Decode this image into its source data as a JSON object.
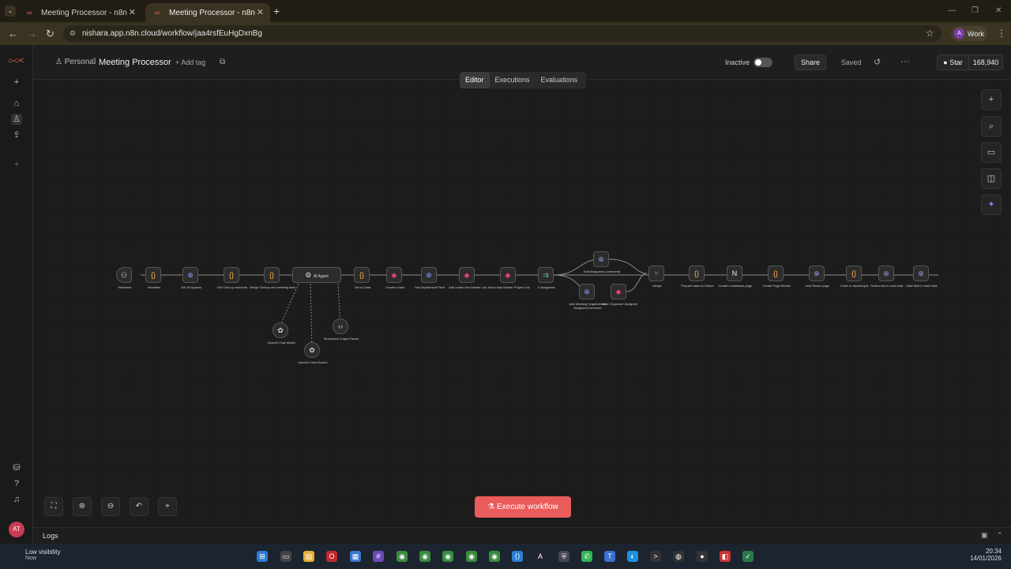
{
  "browser": {
    "tabs": [
      {
        "title": "Meeting Processor - n8n"
      },
      {
        "title": "Meeting Processor - n8n"
      }
    ],
    "url": "nishara.app.n8n.cloud/workflow/jaa4rsfEuHgDxnBg",
    "profile_label": "Work",
    "profile_initial": "A"
  },
  "header": {
    "project": "Personal",
    "workflow_name": "Meeting Processor",
    "add_tag": "+ Add tag",
    "status_label": "Inactive",
    "share_label": "Share",
    "saved_label": "Saved",
    "github_star_label": "Star",
    "github_star_count": "168,940"
  },
  "view_tabs": [
    {
      "label": "Editor",
      "active": true
    },
    {
      "label": "Executions",
      "active": false
    },
    {
      "label": "Evaluations",
      "active": false
    }
  ],
  "canvas": {
    "nodes": [
      {
        "label": "Webhook",
        "icon": "webhook-icon"
      },
      {
        "label": "Variables",
        "icon": "code-icon"
      },
      {
        "label": "Get All Spaces",
        "icon": "http-icon"
      },
      {
        "label": "Get Click up structure",
        "icon": "code-icon"
      },
      {
        "label": "Merge Clickup and meeting data",
        "icon": "code-icon"
      },
      {
        "label": "AI Agent",
        "icon": "robot-icon"
      },
      {
        "label": "Get AI Data",
        "icon": "code-icon"
      },
      {
        "label": "Create a task",
        "icon": "clickup-icon"
      },
      {
        "label": "Set Department Field",
        "icon": "http-icon"
      },
      {
        "label": "Add a task Dev Master List",
        "icon": "clickup-icon"
      },
      {
        "label": "Add a task Master Project List",
        "icon": "clickup-icon"
      },
      {
        "label": "If Assignees",
        "icon": "if-icon"
      },
      {
        "label": "Add Assignees (comment)",
        "icon": "http-icon"
      },
      {
        "label": "Add Meeting Organizer As Assignee/Comment",
        "icon": "http-icon"
      },
      {
        "label": "Make Organizer Assignee",
        "icon": "clickup-icon"
      },
      {
        "label": "Merge",
        "icon": "merge-icon"
      },
      {
        "label": "Prepare data for Notion",
        "icon": "code-icon"
      },
      {
        "label": "Create a database page",
        "icon": "notion-icon"
      },
      {
        "label": "Create Page Blocks",
        "icon": "code-icon"
      },
      {
        "label": "Add Blocks page",
        "icon": "http-icon"
      },
      {
        "label": "Code in JavaScript1",
        "icon": "code-icon"
      },
      {
        "label": "Notion link in each task",
        "icon": "http-icon"
      },
      {
        "label": "Date field in each task",
        "icon": "http-icon"
      },
      {
        "label": "OpenAI Chat Model",
        "icon": "openai-icon"
      },
      {
        "label": "OpenAI Chat Model1",
        "icon": "openai-icon"
      },
      {
        "label": "Structured Output Parser",
        "icon": "parser-icon"
      }
    ],
    "execute_label": "Execute workflow"
  },
  "logs_label": "Logs",
  "taskbar": {
    "weather_title": "Low visibility",
    "weather_sub": "Now",
    "time": "20:34",
    "date": "14/01/2026"
  },
  "colors": {
    "accent": "#ea5b5b",
    "background": "#1c1c1c"
  }
}
